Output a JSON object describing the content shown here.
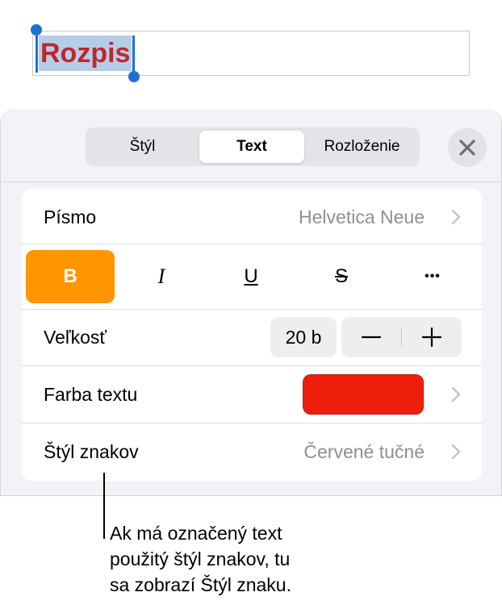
{
  "document": {
    "selected_title": "Rozpis"
  },
  "tabs": [
    {
      "label": "Štýl",
      "active": false
    },
    {
      "label": "Text",
      "active": true
    },
    {
      "label": "Rozloženie",
      "active": false
    }
  ],
  "close_icon": "close-icon",
  "font_row": {
    "label": "Písmo",
    "value": "Helvetica Neue"
  },
  "format_buttons": {
    "bold": "B",
    "italic": "I",
    "underline": "U",
    "strikethrough": "S",
    "more": "•••",
    "bold_active": true
  },
  "size_row": {
    "label": "Veľkosť",
    "value": "20 b",
    "decrement": "−",
    "increment": "+"
  },
  "color_row": {
    "label": "Farba textu",
    "swatch_color": "#ee200d"
  },
  "char_style_row": {
    "label": "Štýl znakov",
    "value": "Červené tučné"
  },
  "callout": {
    "lines": [
      "Ak má označený text",
      "použitý štýl znakov, tu",
      "sa zobrazí Štýl znaku."
    ]
  },
  "colors": {
    "accent_orange": "#ff9500",
    "selection_blue": "#1f6fd6",
    "title_red": "#c0262d"
  }
}
